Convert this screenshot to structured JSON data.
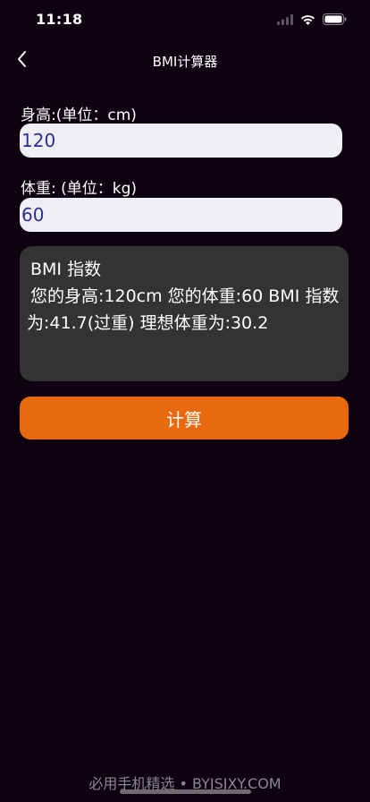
{
  "status_bar": {
    "time": "11:18",
    "icons": [
      "signal-icon",
      "wifi-icon",
      "battery-icon"
    ]
  },
  "nav": {
    "back_icon": "chevron-left-icon",
    "title": "BMI计算器"
  },
  "form": {
    "height_label": "身高:(单位：cm)",
    "height_value": "120",
    "weight_label": "体重: (单位：kg)",
    "weight_value": "60"
  },
  "result": {
    "title": "BMI 指数",
    "text": "您的身高:120cm 您的体重:60 BMI 指数为:41.7(过重) 理想体重为:30.2"
  },
  "calculate_button": {
    "label": "计算"
  },
  "watermark": "必用手机精选 • BYJSJXY.COM",
  "colors": {
    "background": "#0e0210",
    "input_background": "#eeeef4",
    "input_text": "#2a2f8c",
    "panel_background": "#333333",
    "accent": "#e8690e"
  }
}
